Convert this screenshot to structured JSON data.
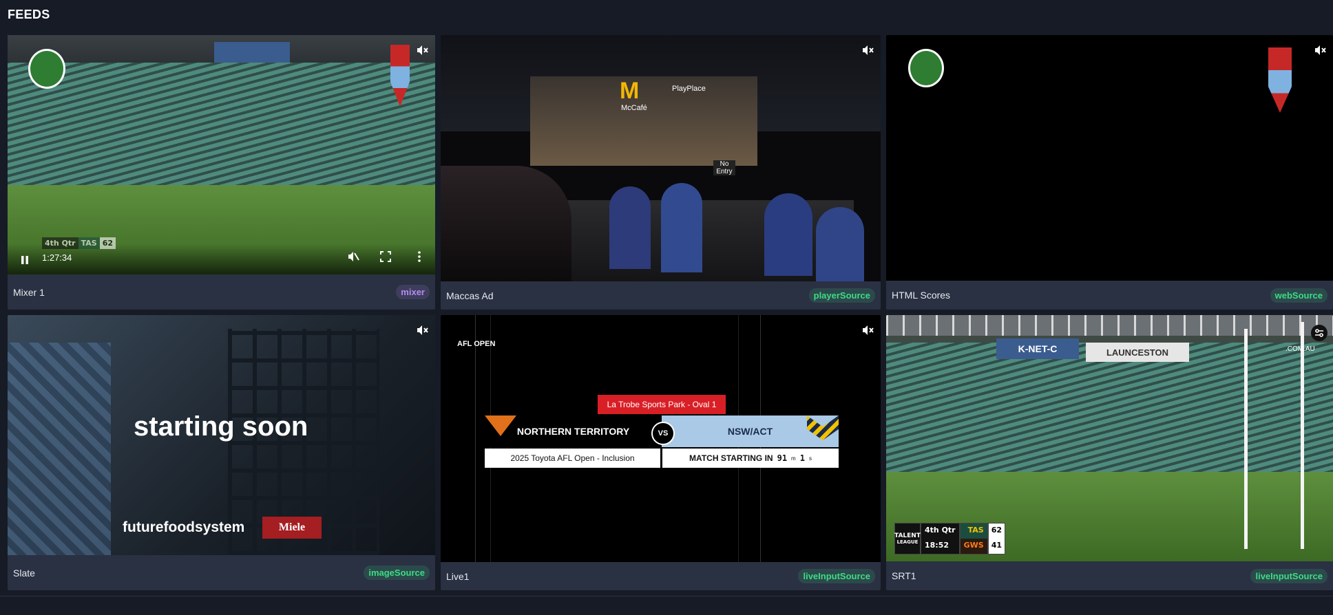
{
  "page": {
    "title": "FEEDS"
  },
  "feeds": [
    {
      "name": "Mixer 1",
      "badge": "mixer",
      "time": "1:27:34",
      "scorebug": {
        "quarter": "4th Qtr",
        "team": "TAS",
        "score": "62"
      }
    },
    {
      "name": "Maccas Ad",
      "badge": "playerSource",
      "sign_text": "PlayPlace",
      "store_text": "McCafé",
      "no_entry": "No Entry"
    },
    {
      "name": "HTML Scores",
      "badge": "webSource"
    },
    {
      "name": "Slate",
      "badge": "imageSource",
      "headline": "starting soon",
      "sponsor_text": "futurefoodsystem",
      "brand": "Miele"
    },
    {
      "name": "Live1",
      "badge": "liveInputSource",
      "logo_text": "AFL OPEN",
      "venue": "La Trobe Sports Park - Oval 1",
      "home_team": "NORTHERN TERRITORY",
      "vs": "VS",
      "away_team": "NSW/ACT",
      "event": "2025 Toyota AFL Open - Inclusion",
      "countdown_label": "MATCH STARTING IN",
      "countdown_min": "91",
      "countdown_min_unit": "m",
      "countdown_sec": "1",
      "countdown_sec_unit": "s"
    },
    {
      "name": "SRT1",
      "badge": "liveInputSource",
      "ad_text": "K-NET-C",
      "ad_text2": "LAUNCESTON",
      "corner_text": ".COM.AU",
      "scorebug": {
        "quarter": "4th Qtr",
        "clock": "18:52",
        "team1": "TAS",
        "score1": "62",
        "team2": "GWS",
        "score2": "41",
        "league": "TALENT",
        "league_sub": "LEAGUE"
      }
    }
  ],
  "colors": {
    "green": "#3ddc84",
    "purple": "#b48cf0",
    "background": "#161b26",
    "card": "#2a3142"
  },
  "icons": {
    "mute": "mute-icon",
    "pause": "pause-icon",
    "fullscreen": "fullscreen-icon",
    "more": "more-vertical-icon",
    "settings": "settings-icon"
  }
}
